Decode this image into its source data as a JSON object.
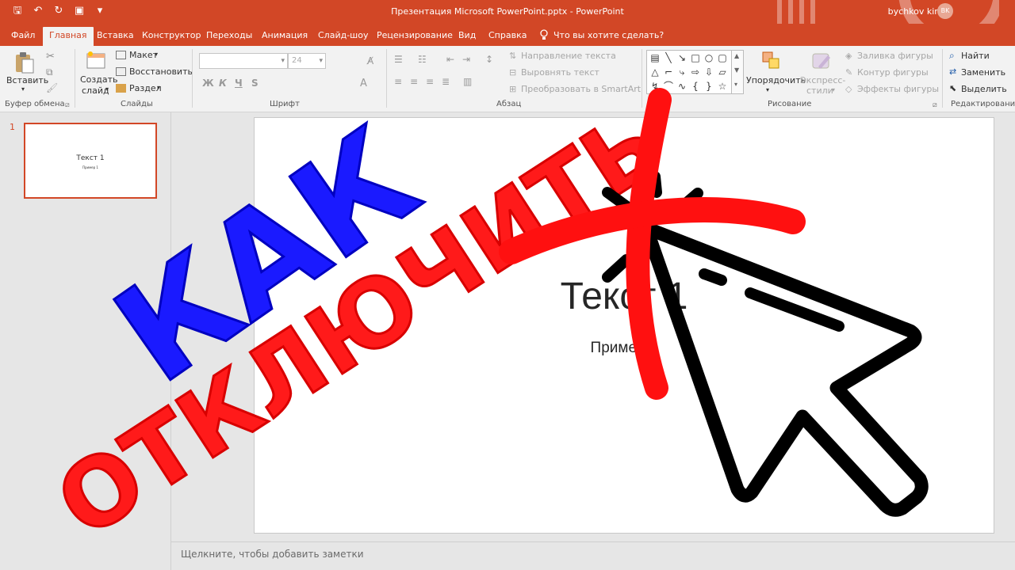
{
  "window": {
    "title": "Презентация Microsoft PowerPoint.pptx  -  PowerPoint",
    "user": "bychkov kirill",
    "avatar_initials": "BK"
  },
  "tabs": [
    "Файл",
    "Главная",
    "Вставка",
    "Конструктор",
    "Переходы",
    "Анимация",
    "Слайд-шоу",
    "Рецензирование",
    "Вид",
    "Справка"
  ],
  "active_tab": "Главная",
  "tell_me": "Что вы хотите сделать?",
  "ribbon": {
    "clipboard": {
      "paste": "Вставить",
      "label": "Буфер обмена"
    },
    "slides": {
      "new_slide_1": "Создать",
      "new_slide_2": "слайд",
      "layout": "Макет",
      "reset": "Восстановить",
      "section": "Раздел",
      "label": "Слайды"
    },
    "font": {
      "size": "24",
      "bold": "Ж",
      "italic": "К",
      "underline": "Ч",
      "shadow": "S",
      "label": "Шрифт"
    },
    "paragraph": {
      "text_direction": "Направление текста",
      "align_text": "Выровнять текст",
      "smartart": "Преобразовать в SmartArt",
      "label": "Абзац"
    },
    "drawing": {
      "arrange": "Упорядочить",
      "quick_styles_1": "Экспресс-",
      "quick_styles_2": "стили",
      "fill": "Заливка фигуры",
      "outline": "Контур фигуры",
      "effects": "Эффекты фигуры",
      "label": "Рисование"
    },
    "editing": {
      "find": "Найти",
      "replace": "Заменить",
      "select": "Выделить",
      "label": "Редактирование"
    }
  },
  "thumbnails": [
    {
      "number": "1",
      "title": "Текст 1",
      "subtitle": "Пример 1"
    }
  ],
  "slide": {
    "title": "Текст 1",
    "subtitle": "Пример 1"
  },
  "notes_placeholder": "Щелкните, чтобы добавить заметки",
  "overlay": {
    "line1": "КАК",
    "line2": "ОТКЛЮЧИТЬ"
  },
  "colors": {
    "accent": "#d24726",
    "overlay_blue": "#1a1aff",
    "overlay_red": "#ff1a1a"
  }
}
